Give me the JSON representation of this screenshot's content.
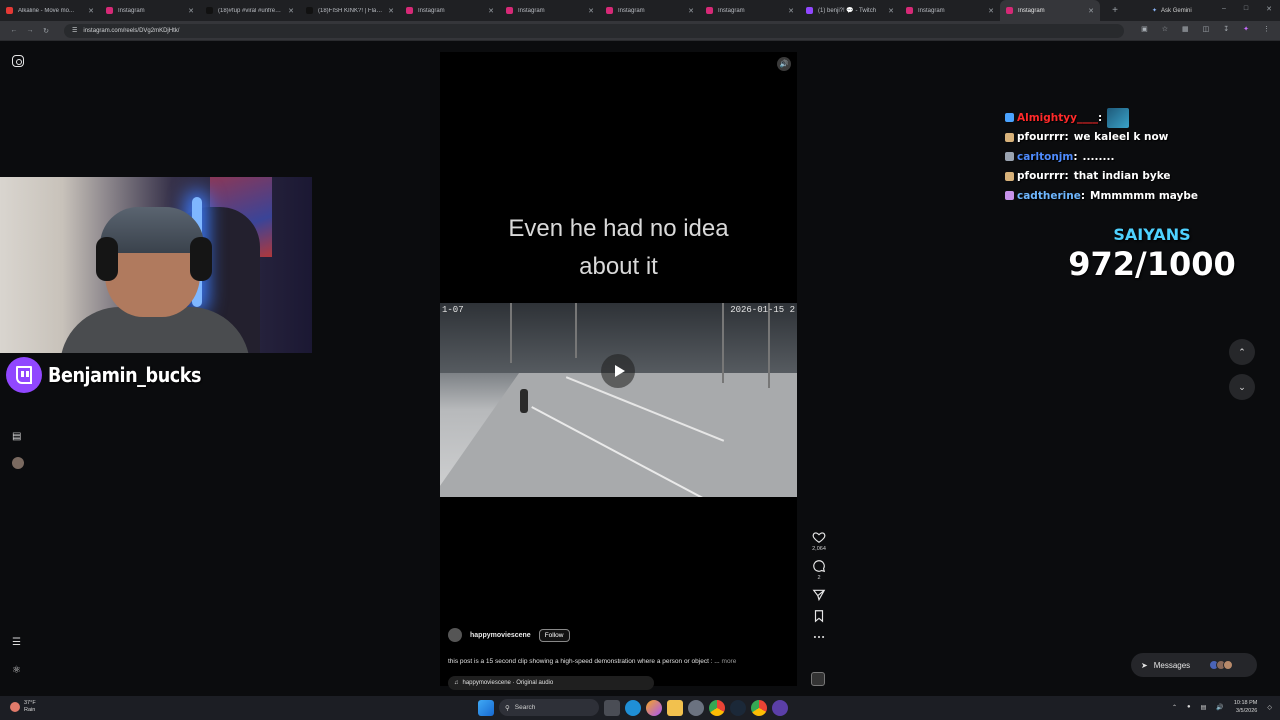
{
  "browser": {
    "tabs": [
      {
        "label": "Alkaline - Move mo...",
        "color": "#e53935"
      },
      {
        "label": "Instagram",
        "color": "#d62976"
      },
      {
        "label": "(18)#fup #viral #unfreeze",
        "color": "#111111"
      },
      {
        "label": "(18)FISH KINK?! | Flamin",
        "color": "#111111"
      },
      {
        "label": "Instagram",
        "color": "#d62976"
      },
      {
        "label": "Instagram",
        "color": "#d62976"
      },
      {
        "label": "Instagram",
        "color": "#d62976"
      },
      {
        "label": "Instagram",
        "color": "#d62976"
      },
      {
        "label": "(1) benji?! 💬 - Twitch",
        "color": "#9147ff"
      },
      {
        "label": "Instagram",
        "color": "#d62976"
      },
      {
        "label": "Instagram",
        "color": "#d62976",
        "active": true
      }
    ],
    "new_tab": "+",
    "ask_gemini": "Ask Gemini",
    "url": "instagram.com/reels/DVg2mKDjHtk/",
    "window_controls": [
      "–",
      "□",
      "✕"
    ]
  },
  "streamer": {
    "name": "Benjamin_bucks"
  },
  "reel": {
    "caption_lines": [
      "Even he had no idea",
      "about it"
    ],
    "timestamp_left": "1-07",
    "timestamp_right": "2026-01-15 2",
    "author": "happymoviescene",
    "follow": "Follow",
    "description": "this post is a 15 second clip showing a high-speed demonstration where a person or object : ...",
    "more": "more",
    "audio": "happymoviescene · Original audio",
    "likes": "2,064",
    "comments": "2"
  },
  "chat": [
    {
      "user": "Almightyy____",
      "color": "#ff2a2a",
      "message": "",
      "emote": true,
      "badge": "#4aa3ff"
    },
    {
      "user": "pfourrrr",
      "color": "#ffffff",
      "message": "we kaleel k now",
      "emote": false,
      "badge": "#d8b27a"
    },
    {
      "user": "carltonjm",
      "color": "#4f8cff",
      "message": "........",
      "emote": false,
      "badge": "#9aa3b0"
    },
    {
      "user": "pfourrrr",
      "color": "#ffffff",
      "message": "that indian byke",
      "emote": false,
      "badge": "#d8b27a"
    },
    {
      "user": "cadtherine",
      "color": "#6fb7ff",
      "message": "Mmmmmm maybe",
      "emote": false,
      "badge": "#c792ea"
    }
  ],
  "goal": {
    "label": "SAIYANS",
    "count": "972/1000"
  },
  "messages": {
    "label": "Messages"
  },
  "taskbar": {
    "temp": "37°F",
    "condition": "Rain",
    "search": "Search",
    "time": "10:18 PM",
    "date": "3/5/2026"
  },
  "colors": {
    "twitch": "#9147ff",
    "goal_label": "#4fd2ff"
  }
}
